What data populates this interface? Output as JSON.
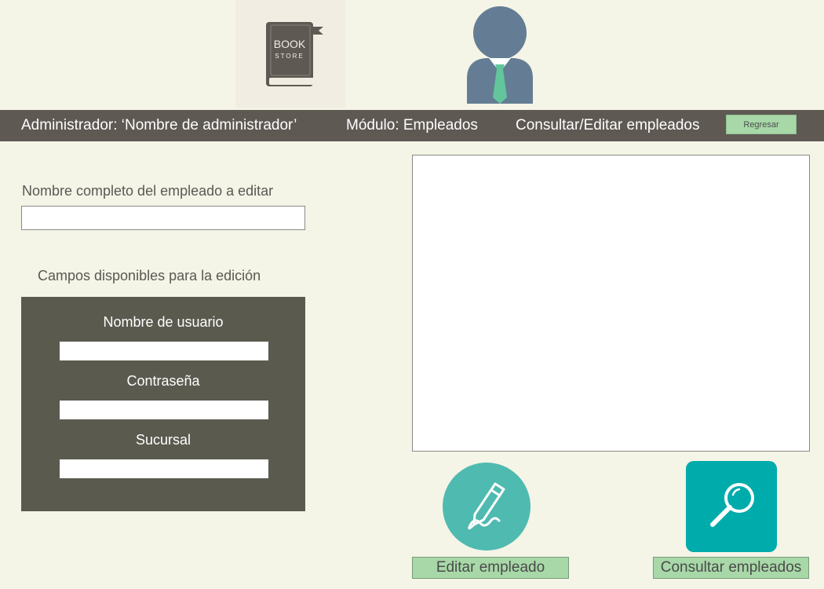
{
  "logo": {
    "line1": "BOOK",
    "line2": "STORE"
  },
  "header": {
    "admin": "Administrador: ‘Nombre de administrador’",
    "module": "Módulo: Empleados",
    "section": "Consultar/Editar empleados",
    "back_label": "Regresar"
  },
  "form": {
    "name_label": "Nombre completo del empleado a editar",
    "name_value": "",
    "fields_label": "Campos disponibles para la edición",
    "fields": [
      {
        "label": "Nombre de usuario",
        "value": ""
      },
      {
        "label": "Contraseña",
        "value": ""
      },
      {
        "label": "Sucursal",
        "value": ""
      }
    ]
  },
  "actions": {
    "edit_label": "Editar empleado",
    "consult_label": "Consultar empleados"
  },
  "icons": {
    "logo": "book-icon",
    "avatar": "user-tie-icon",
    "edit": "pencil-icon",
    "consult": "search-icon"
  },
  "colors": {
    "header_bg": "#5f5954",
    "button_green": "#a8d8a8",
    "panel_bg": "#5a5a4f",
    "edit_icon_bg": "#4fbab0",
    "search_icon_bg": "#00abab"
  }
}
